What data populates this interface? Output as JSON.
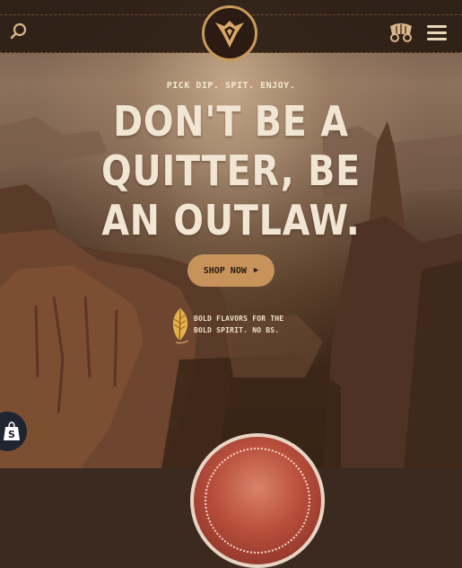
{
  "header": {
    "search_icon": "search-icon",
    "logo_icon": "outlaw-logo-icon",
    "wagon_icon": "covered-wagon-cart-icon",
    "menu_icon": "hamburger-menu-icon"
  },
  "hero": {
    "tagline": "PICK DIP. SPIT. ENJOY.",
    "headline_lines": [
      "DON'T BE A",
      "QUITTER, BE",
      "AN OUTLAW."
    ],
    "cta_label": "SHOP NOW",
    "cta_icon": "chevron-right-icon",
    "promo_icon": "tobacco-leaf-icon",
    "promo_lines": [
      "BOLD FLAVORS FOR THE",
      "BOLD SPIRIT. NO BS."
    ]
  },
  "badges": {
    "shopify_icon": "shopify-bag-icon"
  },
  "colors": {
    "accent": "#c7935a",
    "header_bg": "#2a1c14",
    "headline": "#f1e6d4"
  }
}
